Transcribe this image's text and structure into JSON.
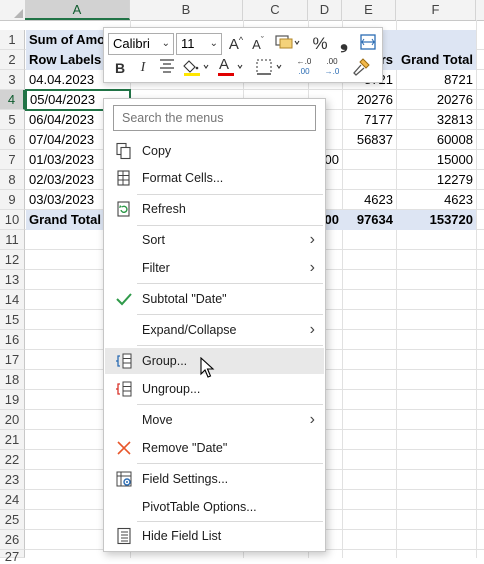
{
  "columns": [
    "A",
    "B",
    "C",
    "D",
    "E",
    "F"
  ],
  "rows": [
    "1",
    "2",
    "3",
    "4",
    "5",
    "6",
    "7",
    "8",
    "9",
    "10",
    "11",
    "12",
    "13",
    "14",
    "15",
    "16",
    "17",
    "18",
    "19",
    "20",
    "21",
    "22",
    "23",
    "24",
    "25",
    "26",
    "27"
  ],
  "cells": {
    "a1": "Sum of Amo",
    "a2": "Row Labels",
    "a3": "04.04.2023",
    "a4": "05/04/2023",
    "a5": "06/04/2023",
    "a6": "07/04/2023",
    "a7": "01/03/2023",
    "a8": "02/03/2023",
    "a9": "03/03/2023",
    "a10": "Grand Total",
    "e2": "rs",
    "f2": "Grand Total",
    "e3": "8721",
    "f3": "8721",
    "e4": "20276",
    "f4": "20276",
    "e5": "7177",
    "f5": "32813",
    "e6": "56837",
    "f6": "60008",
    "d7": "00",
    "f7": "15000",
    "f8": "12279",
    "e9": "4623",
    "f9": "4623",
    "d10": "00",
    "e10": "97634",
    "f10": "153720"
  },
  "mini_toolbar": {
    "font_name": "Calibri",
    "font_size": "11",
    "grow_font": "A",
    "shrink_font": "A",
    "percent": "%",
    "comma": "❟",
    "bold": "B",
    "italic": "I",
    "font_color_letter": "A",
    "decrease_decimal_a": "←.0",
    "decrease_decimal_b": ".00",
    "increase_decimal_a": ".00",
    "increase_decimal_b": "→.0"
  },
  "menu": {
    "search_placeholder": "Search the menus",
    "items": {
      "copy": "Copy",
      "format_cells": "Format Cells...",
      "refresh": "Refresh",
      "sort": "Sort",
      "filter": "Filter",
      "subtotal": "Subtotal \"Date\"",
      "expand_collapse": "Expand/Collapse",
      "group": "Group...",
      "ungroup": "Ungroup...",
      "move": "Move",
      "remove": "Remove \"Date\"",
      "field_settings": "Field Settings...",
      "pivottable_options": "PivotTable Options...",
      "hide_field_list": "Hide Field List"
    },
    "submenu_arrow": "›"
  },
  "colors": {
    "excel_green": "#217346",
    "header_band": "#dde5f3",
    "check_green": "#2f9a4a",
    "remove_orange": "#e8562a",
    "font_color_red": "#e00000",
    "highlight_yellow": "#ffe600"
  },
  "icons": [
    "copy-icon",
    "format-cells-icon",
    "refresh-icon",
    "check-icon",
    "group-icon",
    "ungroup-icon",
    "remove-x-icon",
    "field-settings-icon",
    "field-list-icon",
    "mouse-cursor-icon"
  ]
}
